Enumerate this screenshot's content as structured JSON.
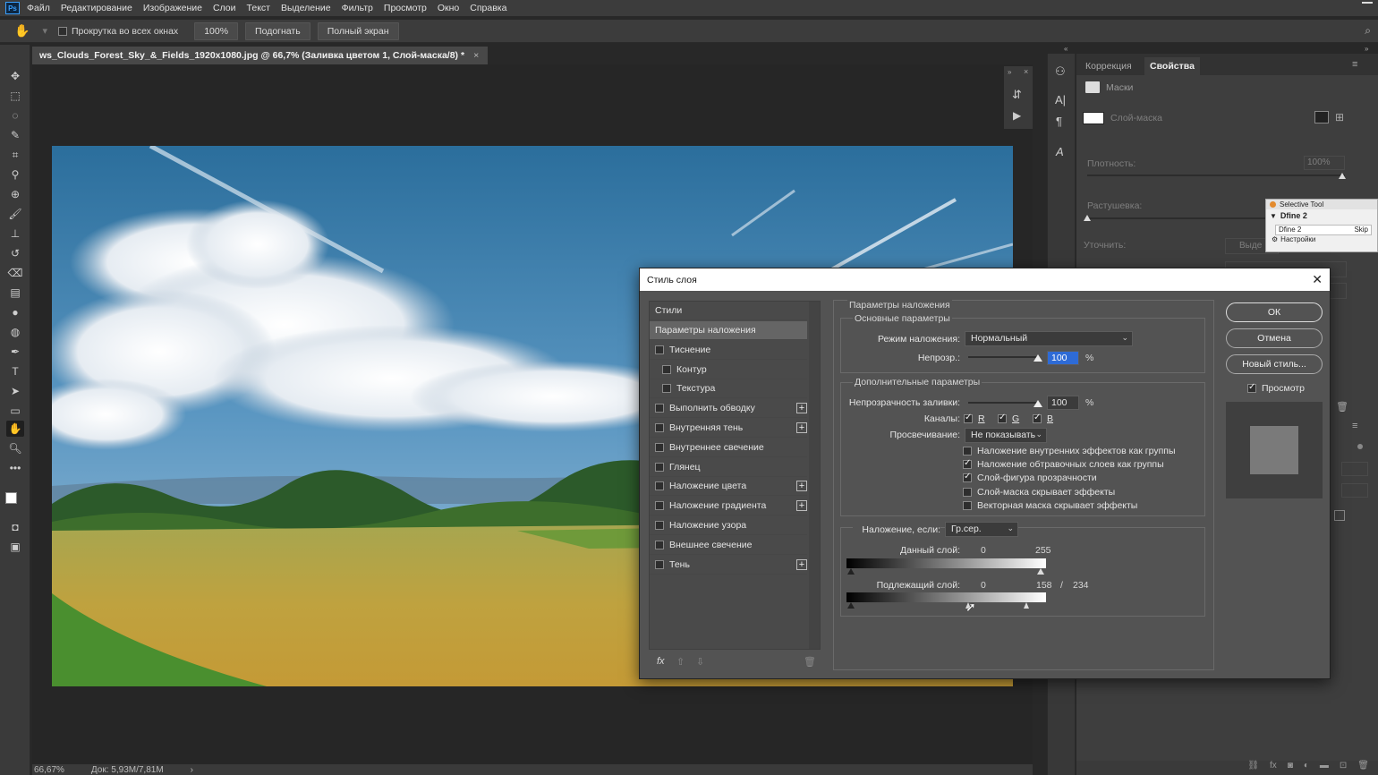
{
  "menu": [
    "Файл",
    "Редактирование",
    "Изображение",
    "Слои",
    "Текст",
    "Выделение",
    "Фильтр",
    "Просмотр",
    "Окно",
    "Справка"
  ],
  "app_logo": "Ps",
  "options": {
    "scroll_all_label": "Прокрутка во всех окнах",
    "zoom_btn": "100%",
    "fit_btn": "Подогнать",
    "fullscreen_btn": "Полный экран"
  },
  "document": {
    "tab_title": "ws_Clouds_Forest_Sky_&_Fields_1920x1080.jpg @ 66,7% (Заливка цветом 1, Слой-маска/8) *",
    "zoom": "66,67%",
    "doc_info": "Док: 5,93M/7,81M"
  },
  "properties": {
    "tab_correction": "Коррекция",
    "tab_properties": "Свойства",
    "masks_label": "Маски",
    "layer_mask_label": "Слой-маска",
    "density_label": "Плотность:",
    "density_value": "100%",
    "feather_label": "Растушевка:",
    "refine_label": "Уточнить:",
    "select_label": "Выде"
  },
  "selective_tool": {
    "title": "Selective Tool",
    "item": "Dfine 2",
    "item2": "Dfine 2",
    "skip": "Skip",
    "settings": "Настройки"
  },
  "dialog": {
    "title": "Стиль слоя",
    "styles_header": "Стили",
    "styles": [
      {
        "label": "Параметры наложения",
        "checkbox": false,
        "checked": false,
        "plus": false,
        "selected": true,
        "indent": false
      },
      {
        "label": "Тиснение",
        "checkbox": true,
        "checked": false,
        "plus": false,
        "selected": false,
        "indent": false
      },
      {
        "label": "Контур",
        "checkbox": true,
        "checked": false,
        "plus": false,
        "selected": false,
        "indent": true
      },
      {
        "label": "Текстура",
        "checkbox": true,
        "checked": false,
        "plus": false,
        "selected": false,
        "indent": true
      },
      {
        "label": "Выполнить обводку",
        "checkbox": true,
        "checked": false,
        "plus": true,
        "selected": false,
        "indent": false
      },
      {
        "label": "Внутренняя тень",
        "checkbox": true,
        "checked": false,
        "plus": true,
        "selected": false,
        "indent": false
      },
      {
        "label": "Внутреннее свечение",
        "checkbox": true,
        "checked": false,
        "plus": false,
        "selected": false,
        "indent": false
      },
      {
        "label": "Глянец",
        "checkbox": true,
        "checked": false,
        "plus": false,
        "selected": false,
        "indent": false
      },
      {
        "label": "Наложение цвета",
        "checkbox": true,
        "checked": false,
        "plus": true,
        "selected": false,
        "indent": false
      },
      {
        "label": "Наложение градиента",
        "checkbox": true,
        "checked": false,
        "plus": true,
        "selected": false,
        "indent": false
      },
      {
        "label": "Наложение узора",
        "checkbox": true,
        "checked": false,
        "plus": false,
        "selected": false,
        "indent": false
      },
      {
        "label": "Внешнее свечение",
        "checkbox": true,
        "checked": false,
        "plus": false,
        "selected": false,
        "indent": false
      },
      {
        "label": "Тень",
        "checkbox": true,
        "checked": false,
        "plus": true,
        "selected": false,
        "indent": false
      }
    ],
    "blend_header": "Параметры наложения",
    "general_header": "Основные параметры",
    "blend_mode_label": "Режим наложения:",
    "blend_mode_value": "Нормальный",
    "opacity_label": "Непрозр.:",
    "opacity_value": "100",
    "opacity_pct": 100,
    "percent": "%",
    "advanced_header": "Дополнительные параметры",
    "fill_opacity_label": "Непрозрачность заливки:",
    "fill_opacity_value": "100",
    "fill_opacity_pct": 100,
    "channels_label": "Каналы:",
    "channel_r": "R",
    "channel_g": "G",
    "channel_b": "B",
    "knockout_label": "Просвечивание:",
    "knockout_value": "Не показывать",
    "advanced_options": [
      {
        "label": "Наложение внутренних эффектов как группы",
        "checked": false
      },
      {
        "label": "Наложение обтравочных слоев как группы",
        "checked": true
      },
      {
        "label": "Слой-фигура прозрачности",
        "checked": true
      },
      {
        "label": "Слой-маска скрывает эффекты",
        "checked": false
      },
      {
        "label": "Векторная маска скрывает эффекты",
        "checked": false
      }
    ],
    "blend_if_label": "Наложение, если:",
    "blend_if_value": "Гр.сер.",
    "this_layer_label": "Данный слой:",
    "this_layer_min": "0",
    "this_layer_max": "255",
    "underlying_label": "Подлежащий слой:",
    "underlying_min": "0",
    "underlying_split_a": "158",
    "underlying_slash": "/",
    "underlying_split_b": "234",
    "ok": "ОК",
    "cancel": "Отмена",
    "new_style": "Новый стиль...",
    "preview": "Просмотр",
    "fx": "fx"
  }
}
